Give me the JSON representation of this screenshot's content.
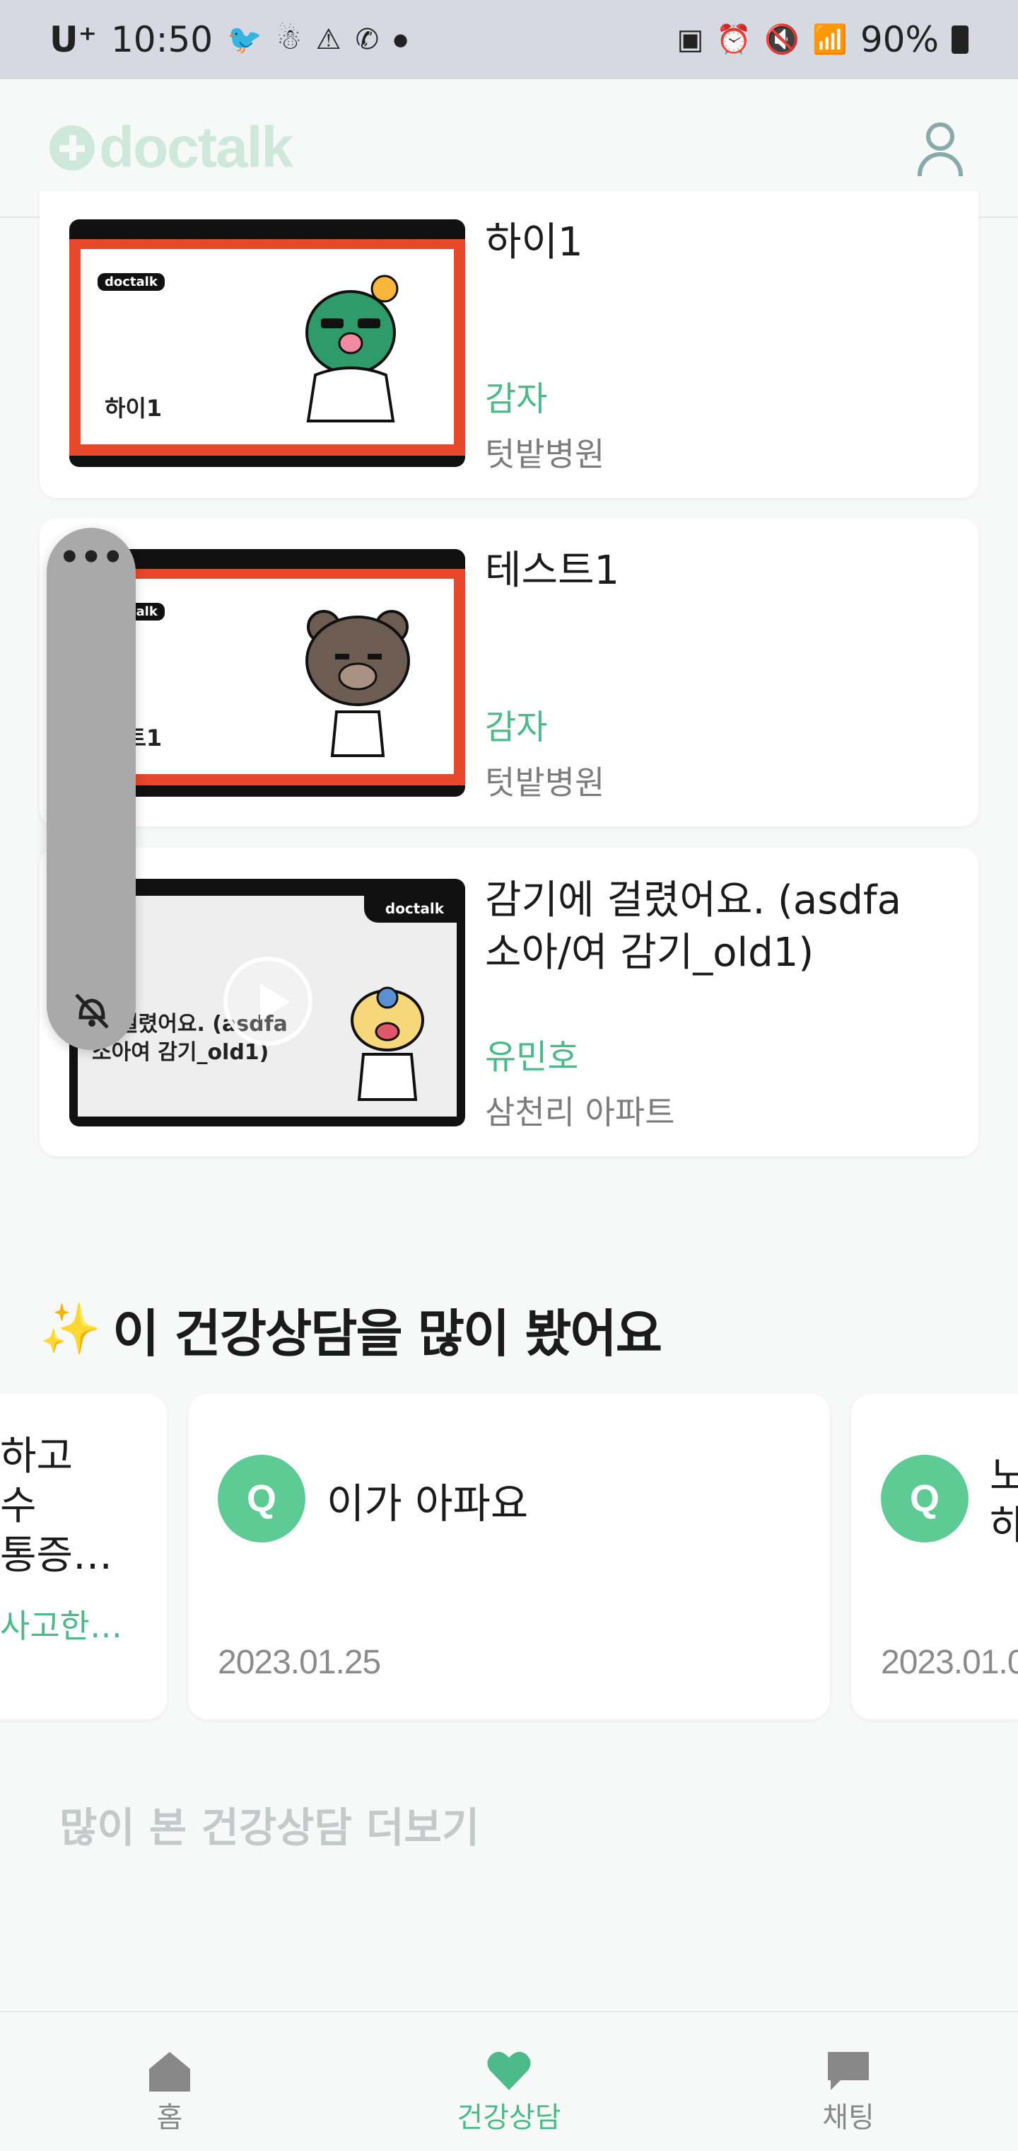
{
  "status_bar": {
    "carrier": "U⁺",
    "time": "10:50",
    "battery": "90%"
  },
  "header": {
    "logo_text": "doctalk"
  },
  "video_cards": [
    {
      "title": "하이1",
      "thumb_title": "하이1",
      "doctor": "감자",
      "hospital": "텃밭병원"
    },
    {
      "title": "테스트1",
      "thumb_title": "스트1",
      "doctor": "감자",
      "hospital": "텃밭병원"
    },
    {
      "title": "감기에 걸렸어요. (asdfa 소아/여 감기_old1)",
      "thumb_title": "에 걸렸어요. (asdfa 소아여 감기_old1)",
      "doctor": "유민호",
      "hospital": "삼천리 아파트"
    }
  ],
  "thumb_brand": "doctalk",
  "floating_panel": {
    "menu_label": "•••"
  },
  "popular_section": {
    "sparkle": "✨",
    "title": "이 건강상담을 많이 봤어요",
    "cards": [
      {
        "question_partial": "하고\n수\n통증…",
        "answer_partial": "사고한…"
      },
      {
        "badge": "Q",
        "question": "이가 아파요",
        "date": "2023.01.25"
      },
      {
        "badge": "Q",
        "question_partial": "노\n하",
        "date_partial": "2023.01.0"
      }
    ],
    "more_label": "많이 본 건강상담 더보기"
  },
  "bottom_nav": {
    "items": [
      {
        "label": "홈",
        "icon": "home-icon",
        "active": false
      },
      {
        "label": "건강상담",
        "icon": "heart-icon",
        "active": true
      },
      {
        "label": "채팅",
        "icon": "chat-icon",
        "active": false
      }
    ]
  },
  "colors": {
    "accent": "#4cb98a",
    "q_badge": "#5ecb95",
    "thumb_frame": "#e7472a"
  }
}
